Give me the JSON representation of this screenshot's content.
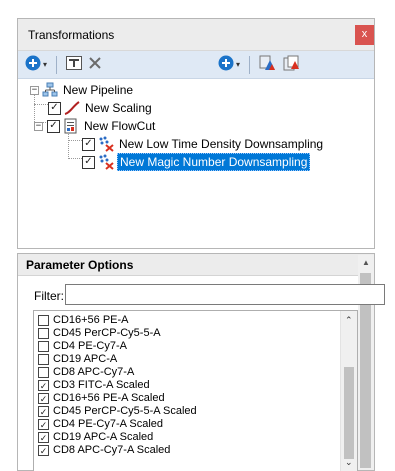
{
  "transformations": {
    "title": "Transformations",
    "close_glyph": "x",
    "toolbar": {
      "add_icon": "plus-circle-icon",
      "rename_icon": "text-edit-icon",
      "delete_icon": "cross-icon",
      "add_right_icon": "plus-circle-icon",
      "copy_icon": "copy-triangle-icon",
      "paste_icon": "paste-triangle-icon",
      "dropdown_glyph": "▾"
    },
    "tree": {
      "pipeline": {
        "label": "New Pipeline",
        "expander": "−",
        "icon": "pipeline-tree-icon"
      },
      "scaling": {
        "label": "New Scaling",
        "checked": true,
        "icon": "curve-icon"
      },
      "flowcut": {
        "label": "New FlowCut",
        "checked": true,
        "expander": "−",
        "icon": "document-chart-icon"
      },
      "low_time": {
        "label": "New Low Time Density Downsampling",
        "checked": true,
        "icon": "downsample-x-icon"
      },
      "magic_number": {
        "label": "New Magic Number Downsampling",
        "checked": true,
        "selected": true,
        "icon": "downsample-x-icon"
      }
    }
  },
  "parameter_options": {
    "title": "Parameter Options",
    "filter": {
      "label": "Filter:",
      "value": "",
      "placeholder": ""
    },
    "items": [
      {
        "label": "CD16+56 PE-A",
        "checked": false
      },
      {
        "label": "CD45 PerCP-Cy5-5-A",
        "checked": false
      },
      {
        "label": "CD4 PE-Cy7-A",
        "checked": false
      },
      {
        "label": "CD19 APC-A",
        "checked": false
      },
      {
        "label": "CD8 APC-Cy7-A",
        "checked": false
      },
      {
        "label": "CD3 FITC-A Scaled",
        "checked": true
      },
      {
        "label": "CD16+56 PE-A Scaled",
        "checked": true
      },
      {
        "label": "CD45 PerCP-Cy5-5-A Scaled",
        "checked": true
      },
      {
        "label": "CD4 PE-Cy7-A Scaled",
        "checked": true
      },
      {
        "label": "CD19 APC-A Scaled",
        "checked": true
      },
      {
        "label": "CD8 APC-Cy7-A Scaled",
        "checked": true
      }
    ],
    "check_glyph": "✓",
    "scroll_up_glyph": "⌃",
    "scroll_down_glyph": "⌄"
  },
  "colors": {
    "selection": "#0078d7",
    "close_button": "#d9534f",
    "toolbar_bg": "#dfe9f5",
    "add_icon": "#1a73c9",
    "scaling_curve": "#b22222",
    "downsample_x": "#d9301f"
  }
}
